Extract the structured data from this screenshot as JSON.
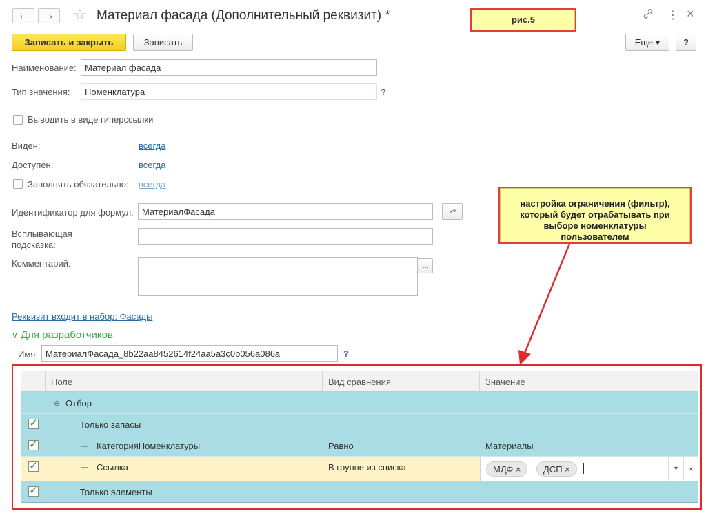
{
  "window": {
    "title": "Материал фасада (Дополнительный реквизит) *",
    "back_icon": "←",
    "forward_icon": "→",
    "star_icon": "☆",
    "link_icon": "🔗",
    "menu_icon": "⋮",
    "close_icon": "×"
  },
  "toolbar": {
    "save_close_label": "Записать и закрыть",
    "save_label": "Записать",
    "more_label": "Еще ▾",
    "help_label": "?"
  },
  "annotation_fig": "рис.5",
  "form": {
    "name_label": "Наименование:",
    "name_value": "Материал фасада",
    "type_label": "Тип значения:",
    "type_value": "Номенклатура",
    "type_help": "?",
    "hyperlink_label": "Выводить в виде гиперссылки",
    "visible_label": "Виден:",
    "visible_value": "всегда",
    "available_label": "Доступен:",
    "available_value": "всегда",
    "required_label": "Заполнять обязательно:",
    "required_value": "всегда",
    "formula_id_label": "Идентификатор для формул:",
    "formula_id_value": "МатериалФасада",
    "tooltip_label": "Всплывающая подсказка:",
    "tooltip_label_line1": "Всплывающая",
    "tooltip_label_line2": "подсказка:",
    "comment_label": "Комментарий:",
    "comment_button": "...",
    "set_link": "Реквизит входит в набор: Фасады",
    "dev_section": "Для разработчиков",
    "dev_chevron": "∨",
    "dev_name_label": "Имя:",
    "dev_name_value": "МатериалФасада_8b22aa8452614f24aa5a3c0b056a086a",
    "dev_help": "?"
  },
  "callout_text_lines": [
    "настройка ограничения (фильтр),",
    "который будет отрабатывать при",
    "выборе номенклатуры",
    "пользователем"
  ],
  "filter_table": {
    "columns": [
      "Поле",
      "Вид сравнения",
      "Значение"
    ],
    "group_label": "Отбор",
    "group_icon": "⊖",
    "rows": [
      {
        "field": "Только запасы",
        "comparison": "",
        "value": ""
      },
      {
        "field": "КатегорияНоменклатуры",
        "comparison": "Равно",
        "value": "Материалы"
      },
      {
        "field": "Ссылка",
        "comparison": "В группе из списка",
        "value": ""
      },
      {
        "field": "Только элементы",
        "comparison": "",
        "value": ""
      }
    ],
    "tags": [
      "МДФ ×",
      "ДСП ×"
    ],
    "dropdown_icon": "▾",
    "clear_icon": "×"
  }
}
